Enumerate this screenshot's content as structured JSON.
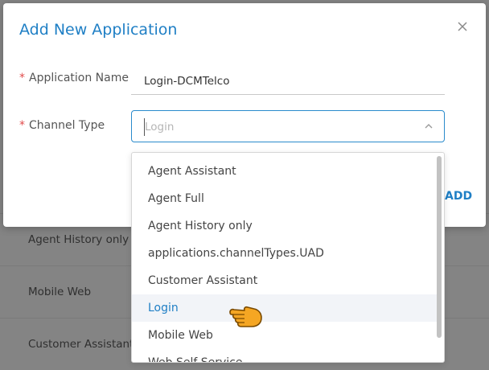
{
  "background_list": {
    "items": [
      "Agent History only",
      "Mobile Web",
      "Customer Assistant"
    ]
  },
  "modal": {
    "title": "Add New Application",
    "close_icon": "close-icon",
    "application_name_label": "Application Name",
    "application_name_value": "Login-DCMTelco",
    "channel_type_label": "Channel Type",
    "channel_type_placeholder": "Login",
    "required_marker": "*",
    "add_label": "ADD"
  },
  "dropdown": {
    "options": [
      "Agent Assistant",
      "Agent Full",
      "Agent History only",
      "applications.channelTypes.UAD",
      "Customer Assistant",
      "Login",
      "Mobile Web",
      "Web Self Service"
    ],
    "highlighted": "Login"
  },
  "colors": {
    "accent": "#1f7fc5",
    "required": "#e14b4b",
    "pointer_hand": "#f5a623"
  }
}
